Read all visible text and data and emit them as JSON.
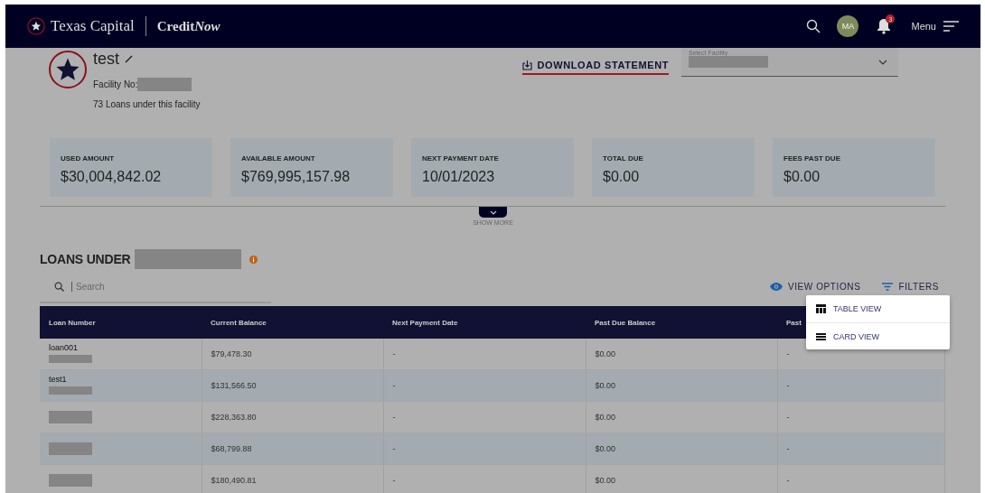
{
  "header": {
    "brand": "Texas Capital",
    "product": "Credit",
    "product_suffix": "Now",
    "avatar_initials": "MA",
    "notification_count": "3",
    "menu_label": "Menu"
  },
  "facility": {
    "name": "test",
    "facility_no_label": "Facility No:",
    "loans_count": "73 Loans under this facility",
    "download_label": "DOWNLOAD STATEMENT",
    "select_label": "Select Facility"
  },
  "summary_cards": [
    {
      "label": "USED AMOUNT",
      "value": "$30,004,842.02"
    },
    {
      "label": "AVAILABLE AMOUNT",
      "value": "$769,995,157.98"
    },
    {
      "label": "NEXT PAYMENT DATE",
      "value": "10/01/2023"
    },
    {
      "label": "TOTAL DUE",
      "value": "$0.00"
    },
    {
      "label": "FEES PAST DUE",
      "value": "$0.00"
    }
  ],
  "show_more": "SHOW MORE",
  "loans": {
    "title": "LOANS UNDER",
    "search_placeholder": "Search",
    "view_options": "VIEW OPTIONS",
    "filters": "FILTERS",
    "view_menu": [
      {
        "kind": "table",
        "label": "TABLE VIEW"
      },
      {
        "kind": "card",
        "label": "CARD VIEW"
      }
    ],
    "columns": [
      "Loan Number",
      "Current Balance",
      "Next Payment Date",
      "Past Due Balance",
      "Past"
    ],
    "rows": [
      {
        "cells": [
          "loan001",
          "$79,478.30",
          "-",
          "$0.00",
          "-"
        ]
      },
      {
        "cells": [
          "test1",
          "$131,566.50",
          "-",
          "$0.00",
          "-"
        ]
      },
      {
        "cells": [
          "",
          "$228,363.80",
          "-",
          "$0.00",
          "-"
        ]
      },
      {
        "cells": [
          "",
          "$68,799.88",
          "-",
          "$0.00",
          "-"
        ]
      },
      {
        "cells": [
          "",
          "$180,490.81",
          "-",
          "$0.00",
          "-"
        ]
      }
    ]
  }
}
